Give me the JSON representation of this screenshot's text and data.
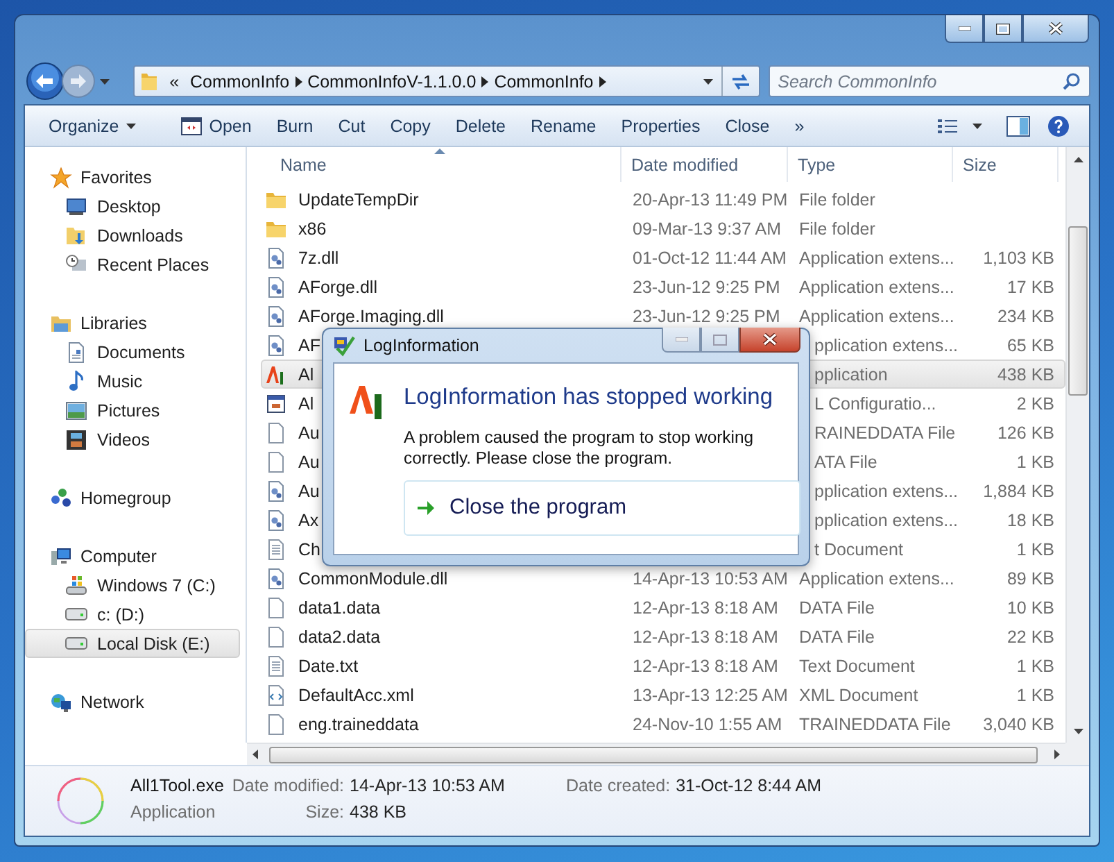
{
  "address_bar": {
    "overflow": "«",
    "crumbs": [
      "CommonInfo",
      "CommonInfoV-1.1.0.0",
      "CommonInfo"
    ]
  },
  "search": {
    "placeholder": "Search CommonInfo"
  },
  "toolbar": {
    "items": [
      {
        "label": "Organize",
        "kind": "menu"
      },
      {
        "label": "Open",
        "kind": "icon"
      },
      {
        "label": "Burn",
        "kind": "plain"
      },
      {
        "label": "Cut",
        "kind": "plain"
      },
      {
        "label": "Copy",
        "kind": "plain"
      },
      {
        "label": "Delete",
        "kind": "plain"
      },
      {
        "label": "Rename",
        "kind": "plain"
      },
      {
        "label": "Properties",
        "kind": "plain"
      },
      {
        "label": "Close",
        "kind": "plain"
      }
    ],
    "more": "»"
  },
  "navigation": [
    {
      "label": "Favorites",
      "selected": false,
      "children": [
        {
          "label": "Desktop",
          "selected": false
        },
        {
          "label": "Downloads",
          "selected": false
        },
        {
          "label": "Recent Places",
          "selected": false
        }
      ]
    },
    {
      "label": "Libraries",
      "selected": false,
      "children": [
        {
          "label": "Documents",
          "selected": false
        },
        {
          "label": "Music",
          "selected": false
        },
        {
          "label": "Pictures",
          "selected": false
        },
        {
          "label": "Videos",
          "selected": false
        }
      ]
    },
    {
      "label": "Homegroup",
      "selected": false
    },
    {
      "label": "Computer",
      "selected": false,
      "children": [
        {
          "label": "Windows 7 (C:)",
          "selected": false
        },
        {
          "label": "c: (D:)",
          "selected": false
        },
        {
          "label": "Local Disk (E:)",
          "selected": true
        }
      ]
    },
    {
      "label": "Network",
      "selected": false
    }
  ],
  "file_list": {
    "columns": [
      "Name",
      "Date modified",
      "Type",
      "Size"
    ],
    "rows": [
      {
        "name": "UpdateTempDir",
        "date": "20-Apr-13 11:49 PM",
        "type": "File folder",
        "kind": "folder",
        "selected": false
      },
      {
        "name": "x86",
        "date": "09-Mar-13 9:37 AM",
        "type": "File folder",
        "kind": "folder",
        "selected": false
      },
      {
        "name": "7z.dll",
        "date": "01-Oct-12 11:44 AM",
        "type": "Application extens...",
        "size": "1,103 KB",
        "kind": "dll",
        "selected": false
      },
      {
        "name": "AForge.dll",
        "date": "23-Jun-12 9:25 PM",
        "type": "Application extens...",
        "size": "17 KB",
        "kind": "dll",
        "selected": false
      },
      {
        "name": "AForge.Imaging.dll",
        "date": "23-Jun-12 9:25 PM",
        "type": "Application extens...",
        "size": "234 KB",
        "kind": "dll",
        "selected": false
      },
      {
        "name": "AF",
        "type": "pplication extens...",
        "size": "65 KB",
        "kind": "dll",
        "selected": false
      },
      {
        "name": "Al",
        "type": "pplication",
        "size": "438 KB",
        "kind": "app",
        "selected": true
      },
      {
        "name": "Al",
        "type": "L Configuratio...",
        "size": "2 KB",
        "kind": "config",
        "selected": false
      },
      {
        "name": "Au",
        "type": "RAINEDDATA File",
        "size": "126 KB",
        "kind": "file",
        "selected": false
      },
      {
        "name": "Au",
        "type": "ATA File",
        "size": "1 KB",
        "kind": "file",
        "selected": false
      },
      {
        "name": "Au",
        "type": "pplication extens...",
        "size": "1,884 KB",
        "kind": "dll",
        "selected": false
      },
      {
        "name": "Ax",
        "type": "pplication extens...",
        "size": "18 KB",
        "kind": "dll",
        "selected": false
      },
      {
        "name": "Ch",
        "type": "t Document",
        "size": "1 KB",
        "kind": "text",
        "selected": false
      },
      {
        "name": "CommonModule.dll",
        "date": "14-Apr-13 10:53 AM",
        "type": "Application extens...",
        "size": "89 KB",
        "kind": "dll",
        "selected": false
      },
      {
        "name": "data1.data",
        "date": "12-Apr-13 8:18 AM",
        "type": "DATA File",
        "size": "10 KB",
        "kind": "file",
        "selected": false
      },
      {
        "name": "data2.data",
        "date": "12-Apr-13 8:18 AM",
        "type": "DATA File",
        "size": "22 KB",
        "kind": "file",
        "selected": false
      },
      {
        "name": "Date.txt",
        "date": "12-Apr-13 8:18 AM",
        "type": "Text Document",
        "size": "1 KB",
        "kind": "text",
        "selected": false
      },
      {
        "name": "DefaultAcc.xml",
        "date": "13-Apr-13 12:25 AM",
        "type": "XML Document",
        "size": "1 KB",
        "kind": "xml",
        "selected": false
      },
      {
        "name": "eng.traineddata",
        "date": "24-Nov-10 1:55 AM",
        "type": "TRAINEDDATA File",
        "size": "3,040 KB",
        "kind": "file",
        "selected": false
      }
    ]
  },
  "dialog": {
    "title": "LogInformation",
    "heading": "LogInformation has stopped working",
    "message": "A problem caused the program to stop working correctly. Please close the program.",
    "action": "Close the program"
  },
  "details": {
    "name": "All1Tool.exe",
    "type": "Application",
    "fields": [
      {
        "label": "Date modified:",
        "value": "14-Apr-13 10:53 AM"
      },
      {
        "label": "Date created:",
        "value": "31-Oct-12 8:44 AM"
      },
      {
        "label": "Size:",
        "value": "438 KB"
      }
    ]
  }
}
